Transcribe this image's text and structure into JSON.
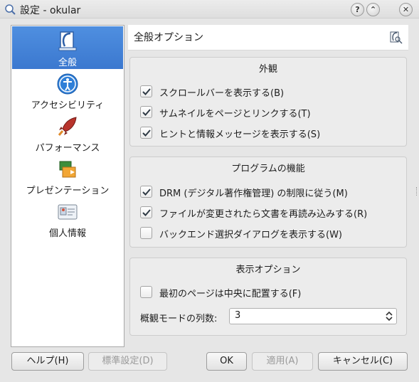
{
  "window": {
    "title": "設定 - okular",
    "help_glyph": "?",
    "collapse_glyph": "⌃",
    "close_glyph": "✕"
  },
  "sidebar": {
    "items": [
      {
        "label": "全般",
        "icon": "okular-general-icon",
        "active": true
      },
      {
        "label": "アクセシビリティ",
        "icon": "accessibility-icon",
        "active": false
      },
      {
        "label": "パフォーマンス",
        "icon": "rocket-icon",
        "active": false
      },
      {
        "label": "プレゼンテーション",
        "icon": "presentation-icon",
        "active": false
      },
      {
        "label": "個人情報",
        "icon": "identity-card-icon",
        "active": false
      }
    ]
  },
  "header": {
    "title": "全般オプション",
    "icon": "okular-icon"
  },
  "groups": {
    "appearance": {
      "title": "外観",
      "options": [
        {
          "label": "スクロールバーを表示する(B)",
          "checked": true
        },
        {
          "label": "サムネイルをページとリンクする(T)",
          "checked": true
        },
        {
          "label": "ヒントと情報メッセージを表示する(S)",
          "checked": true
        }
      ]
    },
    "program": {
      "title": "プログラムの機能",
      "options": [
        {
          "label": "DRM (デジタル著作権管理) の制限に従う(M)",
          "checked": true
        },
        {
          "label": "ファイルが変更されたら文書を再読み込みする(R)",
          "checked": true
        },
        {
          "label": "バックエンド選択ダイアログを表示する(W)",
          "checked": false
        }
      ]
    },
    "view": {
      "title": "表示オプション",
      "options": [
        {
          "label": "最初のページは中央に配置する(F)",
          "checked": false
        }
      ],
      "columns_label": "概観モードの列数:",
      "columns_value": "3"
    }
  },
  "buttons": {
    "help": "ヘルプ(H)",
    "defaults": "標準設定(D)",
    "ok": "OK",
    "apply": "適用(A)",
    "cancel": "キャンセル(C)"
  },
  "colors": {
    "selection": "#3b78cf",
    "check": "#2f3a45"
  }
}
